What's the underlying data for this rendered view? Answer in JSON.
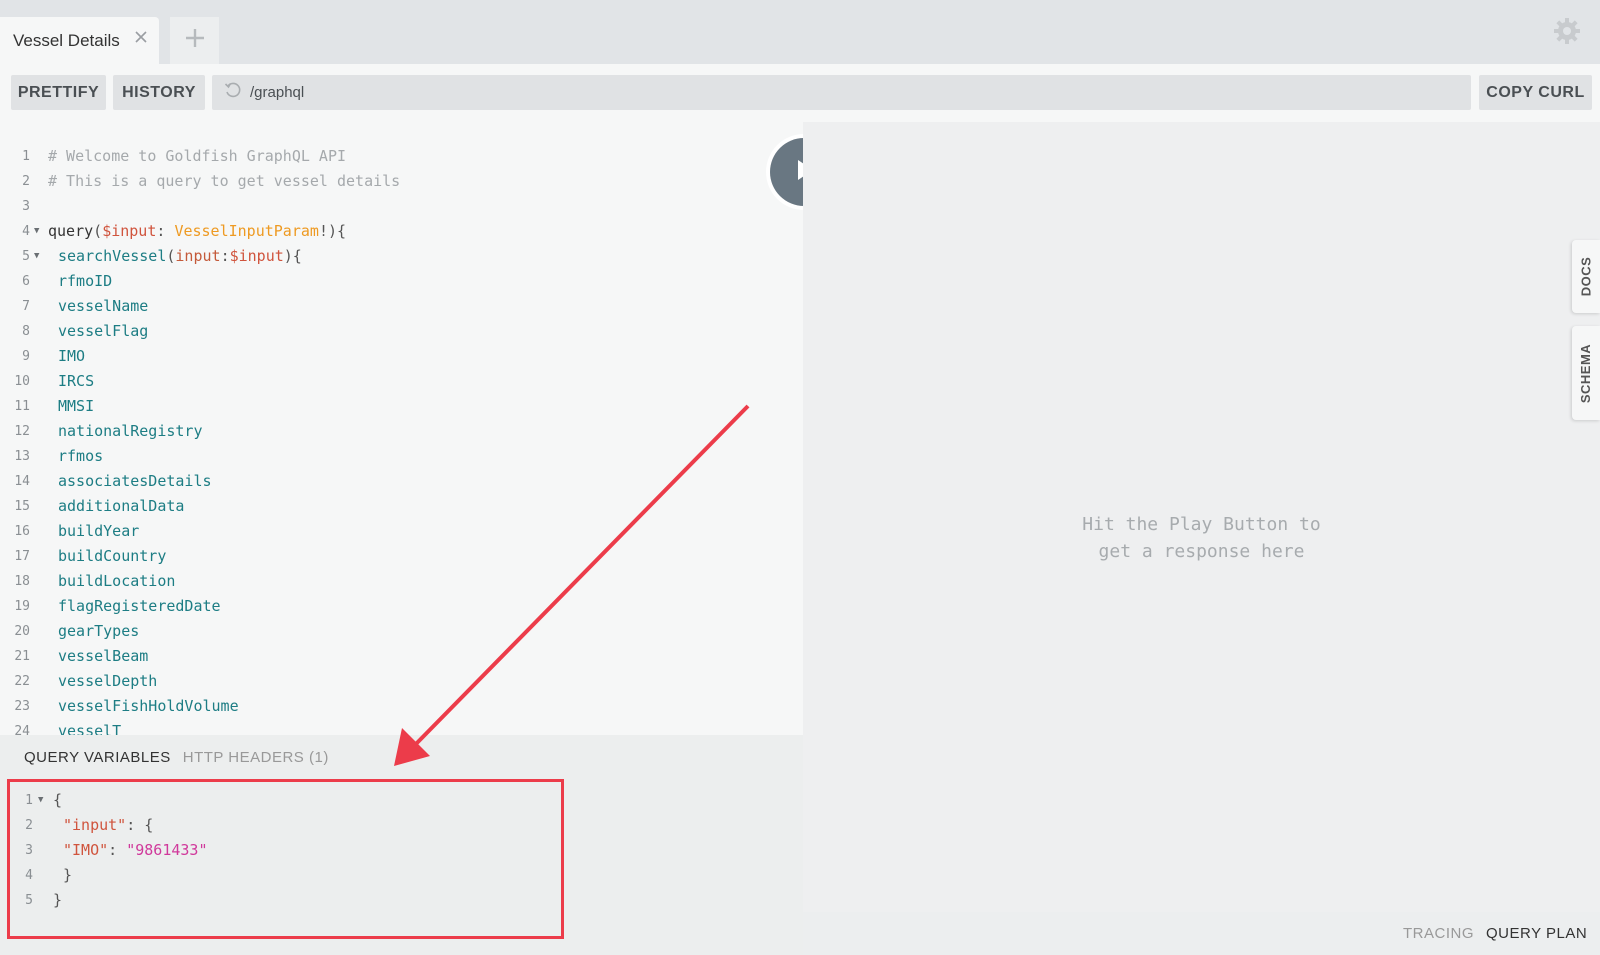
{
  "tabs": [
    {
      "title": "Vessel Details"
    }
  ],
  "toolbar": {
    "prettify_label": "PRETTIFY",
    "history_label": "HISTORY",
    "endpoint": "/graphql",
    "copy_curl_label": "COPY CURL"
  },
  "editor": {
    "lines": [
      {
        "num": "1",
        "tokens": [
          {
            "t": "# Welcome to Goldfish GraphQL API",
            "c": "comment"
          }
        ]
      },
      {
        "num": "2",
        "tokens": [
          {
            "t": "# This is a query to get vessel details",
            "c": "comment"
          }
        ]
      },
      {
        "num": "3",
        "tokens": []
      },
      {
        "num": "4",
        "fold": true,
        "tokens": [
          {
            "t": "query",
            "c": "kw"
          },
          {
            "t": "(",
            "c": "punc"
          },
          {
            "t": "$input",
            "c": "var"
          },
          {
            "t": ": ",
            "c": "punc"
          },
          {
            "t": "VesselInputParam",
            "c": "type"
          },
          {
            "t": "!){",
            "c": "punc"
          }
        ]
      },
      {
        "num": "5",
        "fold": true,
        "indent": 1,
        "tokens": [
          {
            "t": "searchVessel",
            "c": "field"
          },
          {
            "t": "(",
            "c": "punc"
          },
          {
            "t": "input",
            "c": "arg"
          },
          {
            "t": ":",
            "c": "punc"
          },
          {
            "t": "$input",
            "c": "var"
          },
          {
            "t": "){",
            "c": "punc"
          }
        ]
      },
      {
        "num": "6",
        "indent": 1,
        "tokens": [
          {
            "t": "rfmoID",
            "c": "field"
          }
        ]
      },
      {
        "num": "7",
        "indent": 1,
        "tokens": [
          {
            "t": "vesselName",
            "c": "field"
          }
        ]
      },
      {
        "num": "8",
        "indent": 1,
        "tokens": [
          {
            "t": "vesselFlag",
            "c": "field"
          }
        ]
      },
      {
        "num": "9",
        "indent": 1,
        "tokens": [
          {
            "t": "IMO",
            "c": "field"
          }
        ]
      },
      {
        "num": "10",
        "indent": 1,
        "tokens": [
          {
            "t": "IRCS",
            "c": "field"
          }
        ]
      },
      {
        "num": "11",
        "indent": 1,
        "tokens": [
          {
            "t": "MMSI",
            "c": "field"
          }
        ]
      },
      {
        "num": "12",
        "indent": 1,
        "tokens": [
          {
            "t": "nationalRegistry",
            "c": "field"
          }
        ]
      },
      {
        "num": "13",
        "indent": 1,
        "tokens": [
          {
            "t": "rfmos",
            "c": "field"
          }
        ]
      },
      {
        "num": "14",
        "indent": 1,
        "tokens": [
          {
            "t": "associatesDetails",
            "c": "field"
          }
        ]
      },
      {
        "num": "15",
        "indent": 1,
        "tokens": [
          {
            "t": "additionalData",
            "c": "field"
          }
        ]
      },
      {
        "num": "16",
        "indent": 1,
        "tokens": [
          {
            "t": "buildYear",
            "c": "field"
          }
        ]
      },
      {
        "num": "17",
        "indent": 1,
        "tokens": [
          {
            "t": "buildCountry",
            "c": "field"
          }
        ]
      },
      {
        "num": "18",
        "indent": 1,
        "tokens": [
          {
            "t": "buildLocation",
            "c": "field"
          }
        ]
      },
      {
        "num": "19",
        "indent": 1,
        "tokens": [
          {
            "t": "flagRegisteredDate",
            "c": "field"
          }
        ]
      },
      {
        "num": "20",
        "indent": 1,
        "tokens": [
          {
            "t": "gearTypes",
            "c": "field"
          }
        ]
      },
      {
        "num": "21",
        "indent": 1,
        "tokens": [
          {
            "t": "vesselBeam",
            "c": "field"
          }
        ]
      },
      {
        "num": "22",
        "indent": 1,
        "tokens": [
          {
            "t": "vesselDepth",
            "c": "field"
          }
        ]
      },
      {
        "num": "23",
        "indent": 1,
        "tokens": [
          {
            "t": "vesselFishHoldVolume",
            "c": "field"
          }
        ]
      },
      {
        "num": "24",
        "indent": 1,
        "tokens": [
          {
            "t": "vesselT",
            "c": "field"
          }
        ]
      }
    ]
  },
  "variables_panel": {
    "tab_query_variables": "QUERY VARIABLES",
    "tab_http_headers": "HTTP HEADERS (1)",
    "lines": [
      {
        "num": "1",
        "fold": true,
        "tokens": [
          {
            "t": "{",
            "c": "punc"
          }
        ]
      },
      {
        "num": "2",
        "indent": 1,
        "tokens": [
          {
            "t": "\"input\"",
            "c": "key"
          },
          {
            "t": ": {",
            "c": "punc"
          }
        ]
      },
      {
        "num": "3",
        "indent": 1,
        "tokens": [
          {
            "t": "\"IMO\"",
            "c": "key"
          },
          {
            "t": ": ",
            "c": "punc"
          },
          {
            "t": "\"9861433\"",
            "c": "str"
          }
        ]
      },
      {
        "num": "4",
        "indent": 1,
        "tokens": [
          {
            "t": "}",
            "c": "punc"
          }
        ]
      },
      {
        "num": "5",
        "tokens": [
          {
            "t": "}",
            "c": "punc"
          }
        ]
      }
    ]
  },
  "result": {
    "placeholder_line1": "Hit the Play Button to",
    "placeholder_line2": "get a response here"
  },
  "side_tabs": {
    "docs_label": "DOCS",
    "schema_label": "SCHEMA"
  },
  "footer": {
    "tracing_label": "TRACING",
    "query_plan_label": "QUERY PLAN"
  },
  "icons": {
    "tab_close": "close-icon",
    "add_tab": "plus-icon",
    "settings": "gear-icon",
    "reload": "refresh-icon",
    "play": "play-icon"
  },
  "colors": {
    "annotation_red": "#ec3c4a",
    "play_button": "#697782"
  }
}
